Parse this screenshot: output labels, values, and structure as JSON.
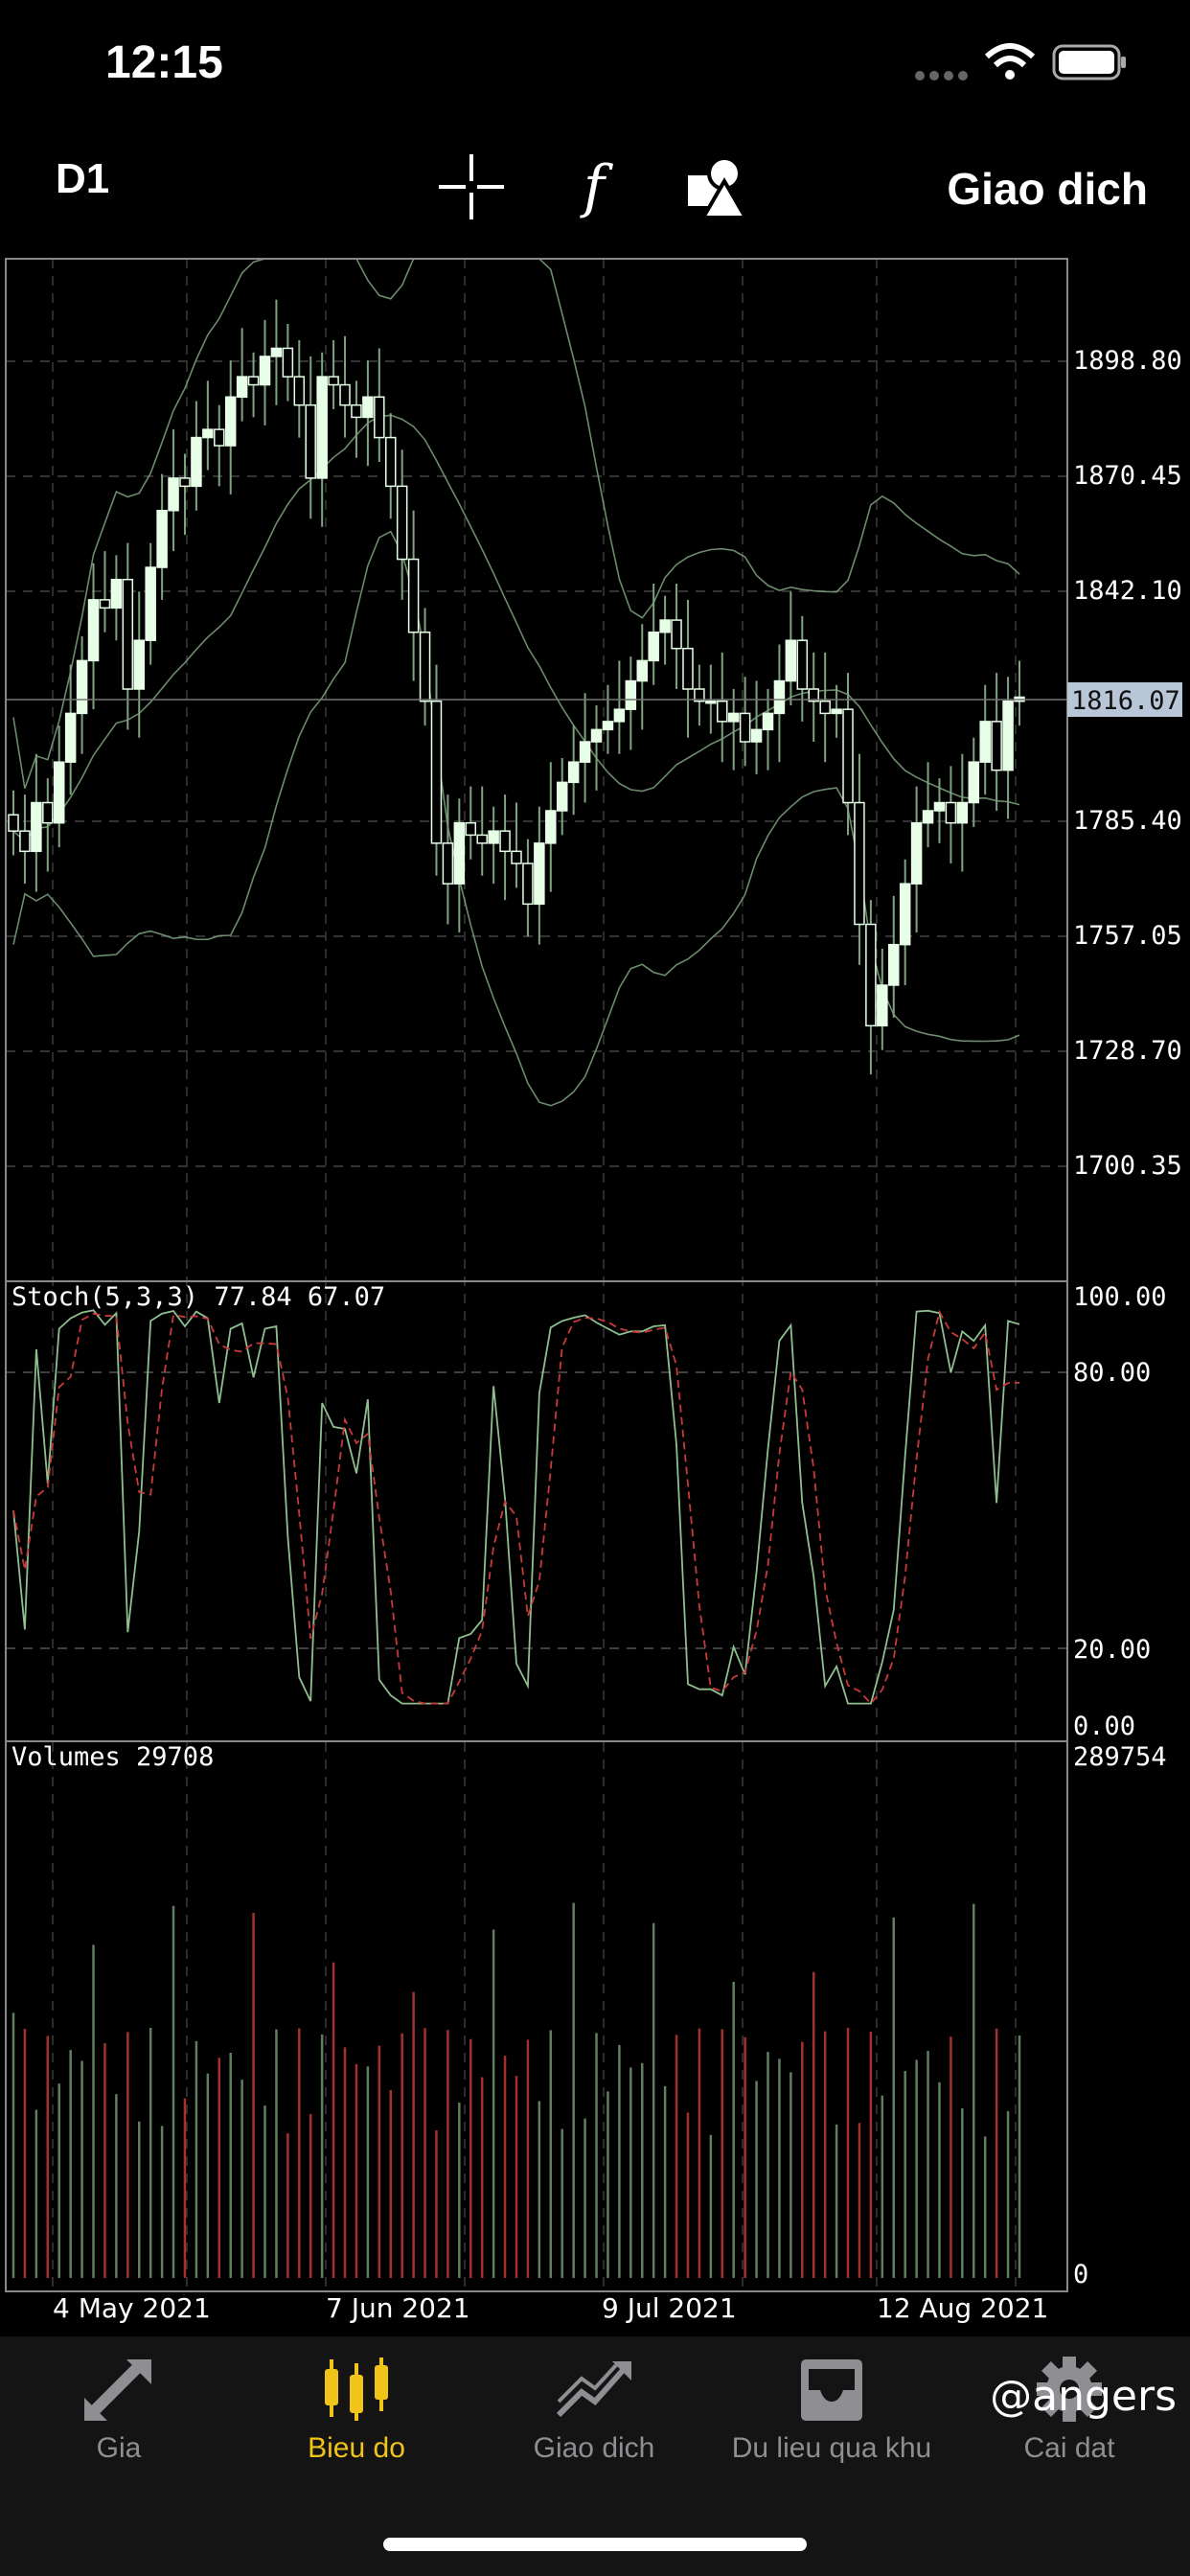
{
  "status_bar": {
    "time": "12:15"
  },
  "toolbar": {
    "period": "D1",
    "crosshair_icon": "crosshair-icon",
    "indicators_icon": "function-icon",
    "objects_icon": "shapes-icon",
    "trade_label": "Giao dich"
  },
  "chart": {
    "price_panel": {
      "ticks": [
        "1898.80",
        "1870.45",
        "1842.10",
        "1785.40",
        "1757.05",
        "1728.70",
        "1700.35"
      ],
      "current_price": "1816.07"
    },
    "stoch_panel": {
      "label": "Stoch(5,3,3) 77.84 67.07",
      "ticks": [
        "100.00",
        "80.00",
        "20.00",
        "0.00"
      ]
    },
    "volume_panel": {
      "label": "Volumes 29708",
      "ticks": [
        "289754",
        "0"
      ]
    },
    "dates": [
      "4 May 2021",
      "7 Jun 2021",
      "9 Jul 2021",
      "12 Aug 2021"
    ]
  },
  "chart_data": {
    "type": "candlestick",
    "price_axis_ticks": [
      1898.8,
      1870.45,
      1842.1,
      1785.4,
      1757.05,
      1728.7,
      1700.35
    ],
    "current_price": 1816.07,
    "candles_close_approx": [
      1783,
      1778,
      1790,
      1785,
      1800,
      1812,
      1825,
      1840,
      1838,
      1845,
      1818,
      1830,
      1848,
      1862,
      1870,
      1868,
      1880,
      1882,
      1878,
      1890,
      1895,
      1893,
      1900,
      1902,
      1895,
      1888,
      1870,
      1895,
      1893,
      1888,
      1885,
      1890,
      1880,
      1868,
      1850,
      1832,
      1815,
      1780,
      1770,
      1785,
      1782,
      1780,
      1783,
      1778,
      1775,
      1765,
      1780,
      1788,
      1795,
      1800,
      1805,
      1808,
      1810,
      1813,
      1820,
      1825,
      1832,
      1835,
      1828,
      1818,
      1815,
      1815,
      1810,
      1812,
      1805,
      1808,
      1812,
      1820,
      1830,
      1818,
      1815,
      1812,
      1813,
      1790,
      1760,
      1735,
      1745,
      1755,
      1770,
      1785,
      1788,
      1790,
      1785,
      1790,
      1800,
      1810,
      1798,
      1815,
      1816
    ],
    "stoch": {
      "params": "5,3,3",
      "main": 77.84,
      "signal": 67.07,
      "levels": [
        20,
        80
      ],
      "range": [
        0,
        100
      ]
    },
    "volume": {
      "last": 29708,
      "max": 289754
    },
    "x_dates": [
      "4 May 2021",
      "7 Jun 2021",
      "9 Jul 2021",
      "12 Aug 2021"
    ]
  },
  "tabs": [
    {
      "label": "Gia",
      "icon": "arrows-icon",
      "active": false
    },
    {
      "label": "Bieu do",
      "icon": "candles-icon",
      "active": true
    },
    {
      "label": "Giao dich",
      "icon": "trend-icon",
      "active": false
    },
    {
      "label": "Du lieu qua khu",
      "icon": "inbox-icon",
      "active": false
    },
    {
      "label": "Cai dat",
      "icon": "gear-icon",
      "active": false
    }
  ],
  "watermark": "@angers",
  "colors": {
    "accent": "#f0c419",
    "candle_up": "#e6ffe6",
    "line": "#7fa37f",
    "signal": "#c83a3a"
  }
}
